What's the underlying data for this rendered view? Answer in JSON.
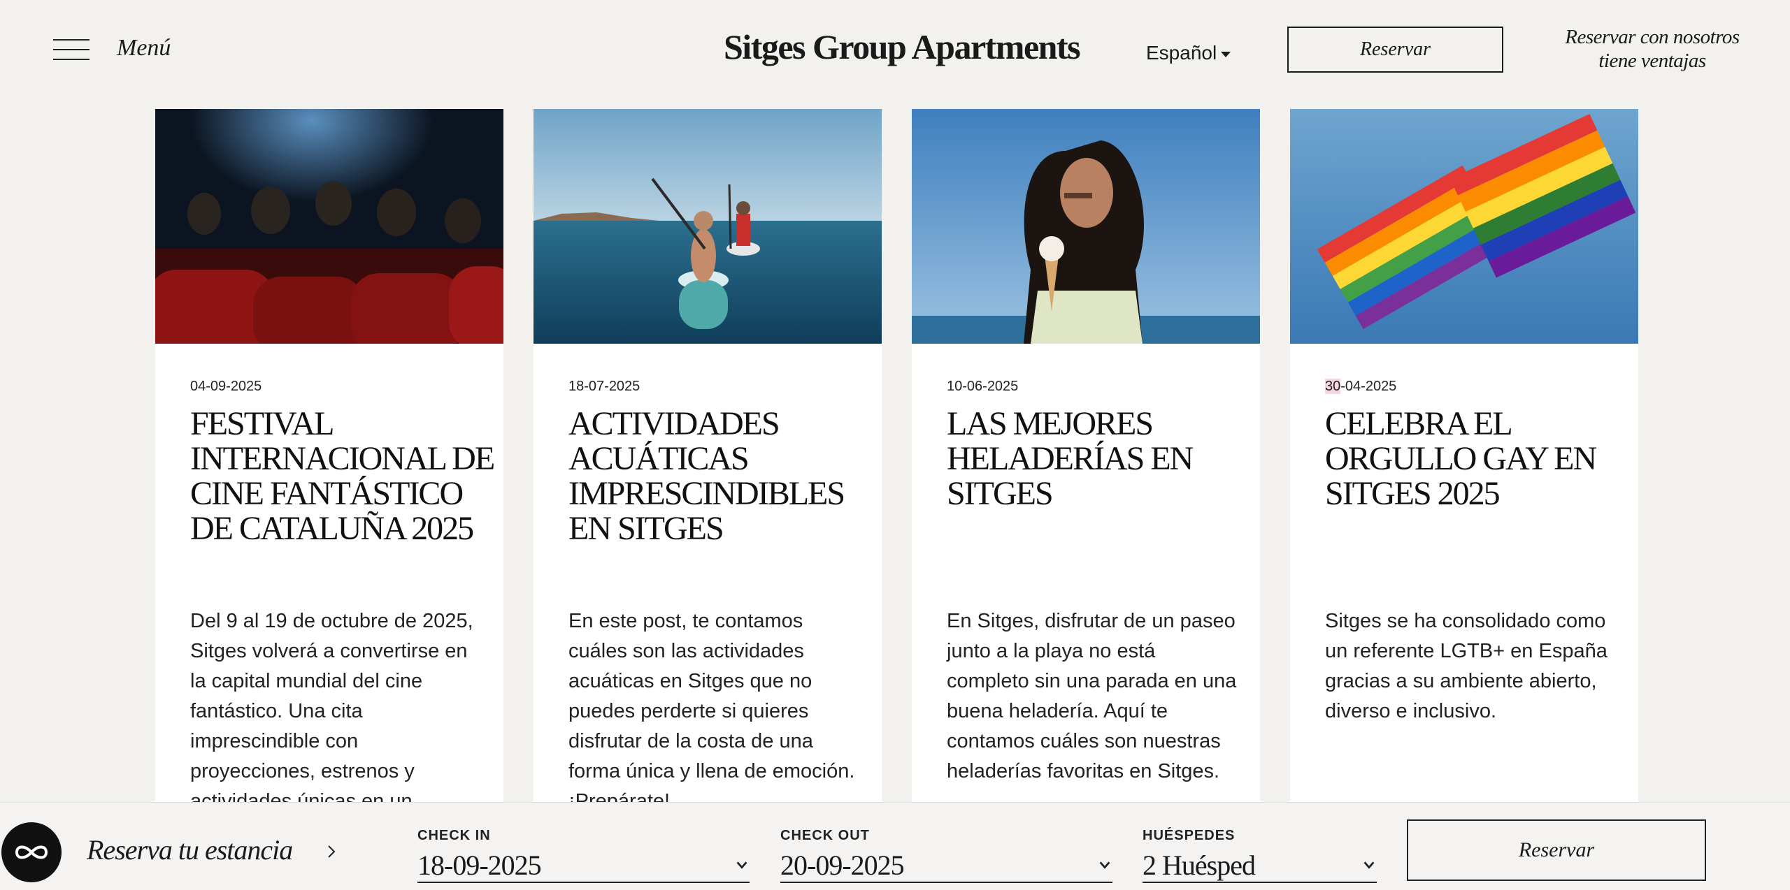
{
  "header": {
    "menu_label": "Menú",
    "brand": "Sitges Group Apartments",
    "language": "Español",
    "reserve_label": "Reservar",
    "promo_line1": "Reservar con nosotros",
    "promo_line2": "tiene ventajas"
  },
  "cards": [
    {
      "image": "cinema-seats-photo",
      "date": "04-09-2025",
      "title": "Festival Internacional de Cine Fantástico de Cataluña 2025",
      "text": "Del 9 al 19 de octubre de 2025, Sitges volverá a convertirse en la capital mundial del cine fantástico. Una cita imprescindible con proyecciones, estrenos y actividades únicas en un"
    },
    {
      "image": "paddle-surf-photo",
      "date": "18-07-2025",
      "title": "Actividades acuáticas imprescindibles en Sitges",
      "text": "En este post, te contamos cuáles son las actividades acuáticas en Sitges que no puedes perderte si quieres disfrutar de la costa de una forma única y llena de emoción. ¡Prepárate!"
    },
    {
      "image": "woman-ice-cream-photo",
      "date": "10-06-2025",
      "title": "Las mejores heladerías en Sitges",
      "text": "En Sitges, disfrutar de un paseo junto a la playa no está completo sin una parada en una buena heladería. Aquí te contamos cuáles son nuestras heladerías favoritas en Sitges."
    },
    {
      "image": "rainbow-flags-photo",
      "date_day": "30",
      "date_rest": "-04-2025",
      "title": "Celebra el orgullo gay en Sitges 2025",
      "text": "Sitges se ha consolidado como un referente LGTB+ en España gracias a su ambiente abierto, diverso e inclusivo."
    }
  ],
  "booking": {
    "label": "Reserva tu estancia",
    "check_in_label": "CHECK IN",
    "check_in_value": "18-09-2025",
    "check_out_label": "CHECK OUT",
    "check_out_value": "20-09-2025",
    "guests_label": "HUÉSPEDES",
    "guests_value": "2 Huésped",
    "reserve_label": "Reservar"
  }
}
